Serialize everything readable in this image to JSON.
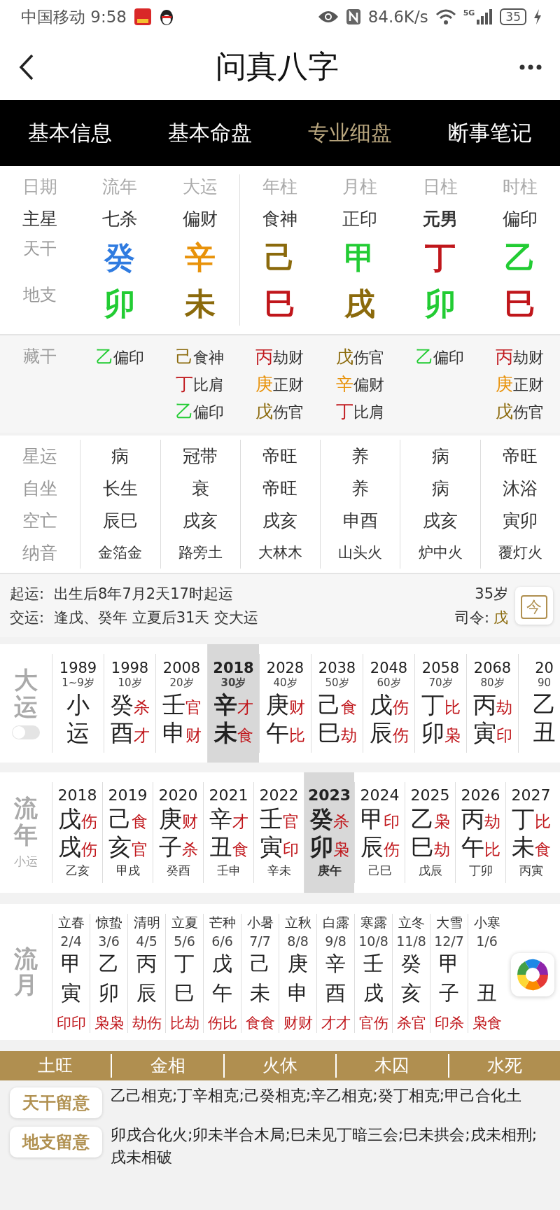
{
  "status_bar": {
    "carrier_time": "中国移动 9:58",
    "speed": "84.6K/s",
    "network": "5G",
    "battery": "35"
  },
  "nav": {
    "title": "问真八字"
  },
  "tabs": [
    {
      "label": "基本信息",
      "selected": false
    },
    {
      "label": "基本命盘",
      "selected": false
    },
    {
      "label": "专业细盘",
      "selected": true
    },
    {
      "label": "断事笔记",
      "selected": false
    }
  ],
  "pillars": {
    "row_labels": [
      "日期",
      "主星",
      "天干",
      "地支"
    ],
    "columns": [
      {
        "header": "流年",
        "star": "七杀",
        "bold": false,
        "stem": {
          "text": "癸",
          "color": "#2f7be0"
        },
        "branch": {
          "text": "卯",
          "color": "#22cc33"
        }
      },
      {
        "header": "大运",
        "star": "偏财",
        "bold": false,
        "stem": {
          "text": "辛",
          "color": "#e8920a"
        },
        "branch": {
          "text": "未",
          "color": "#8b6a0c"
        }
      },
      {
        "header": "年柱",
        "star": "食神",
        "bold": false,
        "stem": {
          "text": "己",
          "color": "#8b6a0c"
        },
        "branch": {
          "text": "巳",
          "color": "#c0161b"
        }
      },
      {
        "header": "月柱",
        "star": "正印",
        "bold": false,
        "stem": {
          "text": "甲",
          "color": "#22cc33"
        },
        "branch": {
          "text": "戌",
          "color": "#8b6a0c"
        }
      },
      {
        "header": "日柱",
        "star": "元男",
        "bold": true,
        "stem": {
          "text": "丁",
          "color": "#c0161b"
        },
        "branch": {
          "text": "卯",
          "color": "#22cc33"
        }
      },
      {
        "header": "时柱",
        "star": "偏印",
        "bold": false,
        "stem": {
          "text": "乙",
          "color": "#22cc33"
        },
        "branch": {
          "text": "巳",
          "color": "#c0161b"
        }
      }
    ]
  },
  "hidden_stems": {
    "label": "藏干",
    "columns": [
      [
        {
          "stem": "乙",
          "color": "#22cc33",
          "god": "偏印"
        }
      ],
      [
        {
          "stem": "己",
          "color": "#8b6a0c",
          "god": "食神"
        },
        {
          "stem": "丁",
          "color": "#c0161b",
          "god": "比肩"
        },
        {
          "stem": "乙",
          "color": "#22cc33",
          "god": "偏印"
        }
      ],
      [
        {
          "stem": "丙",
          "color": "#c0161b",
          "god": "劫财"
        },
        {
          "stem": "庚",
          "color": "#e8920a",
          "god": "正财"
        },
        {
          "stem": "戊",
          "color": "#8b6a0c",
          "god": "伤官"
        }
      ],
      [
        {
          "stem": "戊",
          "color": "#8b6a0c",
          "god": "伤官"
        },
        {
          "stem": "辛",
          "color": "#e8920a",
          "god": "偏财"
        },
        {
          "stem": "丁",
          "color": "#c0161b",
          "god": "比肩"
        }
      ],
      [
        {
          "stem": "乙",
          "color": "#22cc33",
          "god": "偏印"
        }
      ],
      [
        {
          "stem": "丙",
          "color": "#c0161b",
          "god": "劫财"
        },
        {
          "stem": "庚",
          "color": "#e8920a",
          "god": "正财"
        },
        {
          "stem": "戊",
          "color": "#8b6a0c",
          "god": "伤官"
        }
      ]
    ]
  },
  "star_table": [
    {
      "label": "星运",
      "kind": "normal",
      "values": [
        "病",
        "冠带",
        "帝旺",
        "养",
        "病",
        "帝旺"
      ]
    },
    {
      "label": "自坐",
      "kind": "normal",
      "values": [
        "长生",
        "衰",
        "帝旺",
        "养",
        "病",
        "沐浴"
      ]
    },
    {
      "label": "空亡",
      "kind": "normal",
      "values": [
        "辰巳",
        "戌亥",
        "戌亥",
        "申酉",
        "戌亥",
        "寅卯"
      ]
    },
    {
      "label": "纳音",
      "kind": "small",
      "values": [
        "金箔金",
        "路旁土",
        "大林木",
        "山头火",
        "炉中火",
        "覆灯火"
      ]
    }
  ],
  "luck_start": {
    "start_label": "起运:",
    "start_text": "出生后8年7月2天17时起运",
    "switch_label": "交运:",
    "switch_text": "逢戊、癸年 立夏后31天 交大运",
    "age": "35岁",
    "commander_label": "司令:",
    "commander": "戊",
    "today_button": "今"
  },
  "dayun": {
    "label": "大运",
    "toggle": {
      "on": false
    },
    "columns": [
      {
        "year": "1989",
        "age": "1~9岁",
        "stem": "小",
        "branch": "运",
        "selected": false
      },
      {
        "year": "1998",
        "age": "10岁",
        "stem": "癸",
        "stem_god": "杀",
        "branch": "酉",
        "branch_god": "才",
        "selected": false
      },
      {
        "year": "2008",
        "age": "20岁",
        "stem": "壬",
        "stem_god": "官",
        "branch": "申",
        "branch_god": "财",
        "selected": false
      },
      {
        "year": "2018",
        "age": "30岁",
        "stem": "辛",
        "stem_god": "才",
        "branch": "未",
        "branch_god": "食",
        "selected": true
      },
      {
        "year": "2028",
        "age": "40岁",
        "stem": "庚",
        "stem_god": "财",
        "branch": "午",
        "branch_god": "比",
        "selected": false
      },
      {
        "year": "2038",
        "age": "50岁",
        "stem": "己",
        "stem_god": "食",
        "branch": "巳",
        "branch_god": "劫",
        "selected": false
      },
      {
        "year": "2048",
        "age": "60岁",
        "stem": "戊",
        "stem_god": "伤",
        "branch": "辰",
        "branch_god": "伤",
        "selected": false
      },
      {
        "year": "2058",
        "age": "70岁",
        "stem": "丁",
        "stem_god": "比",
        "branch": "卯",
        "branch_god": "枭",
        "selected": false
      },
      {
        "year": "2068",
        "age": "80岁",
        "stem": "丙",
        "stem_god": "劫",
        "branch": "寅",
        "branch_god": "印",
        "selected": false
      },
      {
        "year": "20",
        "age": "90",
        "stem": "乙",
        "branch": "丑",
        "selected": false
      }
    ]
  },
  "liunian": {
    "label": "流年",
    "sublabel": "小运",
    "columns": [
      {
        "year": "2018",
        "stem": "戊",
        "stem_god": "伤",
        "branch": "戌",
        "branch_god": "伤",
        "xiaoyun": "乙亥",
        "selected": false
      },
      {
        "year": "2019",
        "stem": "己",
        "stem_god": "食",
        "branch": "亥",
        "branch_god": "官",
        "xiaoyun": "甲戌",
        "selected": false
      },
      {
        "year": "2020",
        "stem": "庚",
        "stem_god": "财",
        "branch": "子",
        "branch_god": "杀",
        "xiaoyun": "癸酉",
        "selected": false
      },
      {
        "year": "2021",
        "stem": "辛",
        "stem_god": "才",
        "branch": "丑",
        "branch_god": "食",
        "xiaoyun": "壬申",
        "selected": false
      },
      {
        "year": "2022",
        "stem": "壬",
        "stem_god": "官",
        "branch": "寅",
        "branch_god": "印",
        "xiaoyun": "辛未",
        "selected": false
      },
      {
        "year": "2023",
        "stem": "癸",
        "stem_god": "杀",
        "branch": "卯",
        "branch_god": "枭",
        "xiaoyun": "庚午",
        "selected": true
      },
      {
        "year": "2024",
        "stem": "甲",
        "stem_god": "印",
        "branch": "辰",
        "branch_god": "伤",
        "xiaoyun": "己巳",
        "selected": false
      },
      {
        "year": "2025",
        "stem": "乙",
        "stem_god": "枭",
        "branch": "巳",
        "branch_god": "劫",
        "xiaoyun": "戊辰",
        "selected": false
      },
      {
        "year": "2026",
        "stem": "丙",
        "stem_god": "劫",
        "branch": "午",
        "branch_god": "比",
        "xiaoyun": "丁卯",
        "selected": false
      },
      {
        "year": "2027",
        "stem": "丁",
        "stem_god": "比",
        "branch": "未",
        "branch_god": "食",
        "xiaoyun": "丙寅",
        "selected": false
      }
    ]
  },
  "liuyue": {
    "label": "流月",
    "columns": [
      {
        "term": "立春",
        "date": "2/4",
        "stem": "甲",
        "branch": "寅",
        "gods": "印印"
      },
      {
        "term": "惊蛰",
        "date": "3/6",
        "stem": "乙",
        "branch": "卯",
        "gods": "枭枭"
      },
      {
        "term": "清明",
        "date": "4/5",
        "stem": "丙",
        "branch": "辰",
        "gods": "劫伤"
      },
      {
        "term": "立夏",
        "date": "5/6",
        "stem": "丁",
        "branch": "巳",
        "gods": "比劫"
      },
      {
        "term": "芒种",
        "date": "6/6",
        "stem": "戊",
        "branch": "午",
        "gods": "伤比"
      },
      {
        "term": "小暑",
        "date": "7/7",
        "stem": "己",
        "branch": "未",
        "gods": "食食"
      },
      {
        "term": "立秋",
        "date": "8/8",
        "stem": "庚",
        "branch": "申",
        "gods": "财财"
      },
      {
        "term": "白露",
        "date": "9/8",
        "stem": "辛",
        "branch": "酉",
        "gods": "才才"
      },
      {
        "term": "寒露",
        "date": "10/8",
        "stem": "壬",
        "branch": "戌",
        "gods": "官伤"
      },
      {
        "term": "立冬",
        "date": "11/8",
        "stem": "癸",
        "branch": "亥",
        "gods": "杀官"
      },
      {
        "term": "大雪",
        "date": "12/7",
        "stem": "甲",
        "branch": "子",
        "gods": "印杀"
      },
      {
        "term": "小寒",
        "date": "1/6",
        "branch": "丑",
        "gods": "枭食"
      }
    ]
  },
  "wuxing": [
    "土旺",
    "金相",
    "火休",
    "木囚",
    "水死"
  ],
  "notes": [
    {
      "label": "天干留意",
      "text": "乙己相克;丁辛相克;己癸相克;辛乙相克;癸丁相克;甲己合化土"
    },
    {
      "label": "地支留意",
      "text": "卯戌合化火;卯未半合木局;巳未见丁暗三会;巳未拱会;戌未相刑;戌未相破"
    }
  ]
}
